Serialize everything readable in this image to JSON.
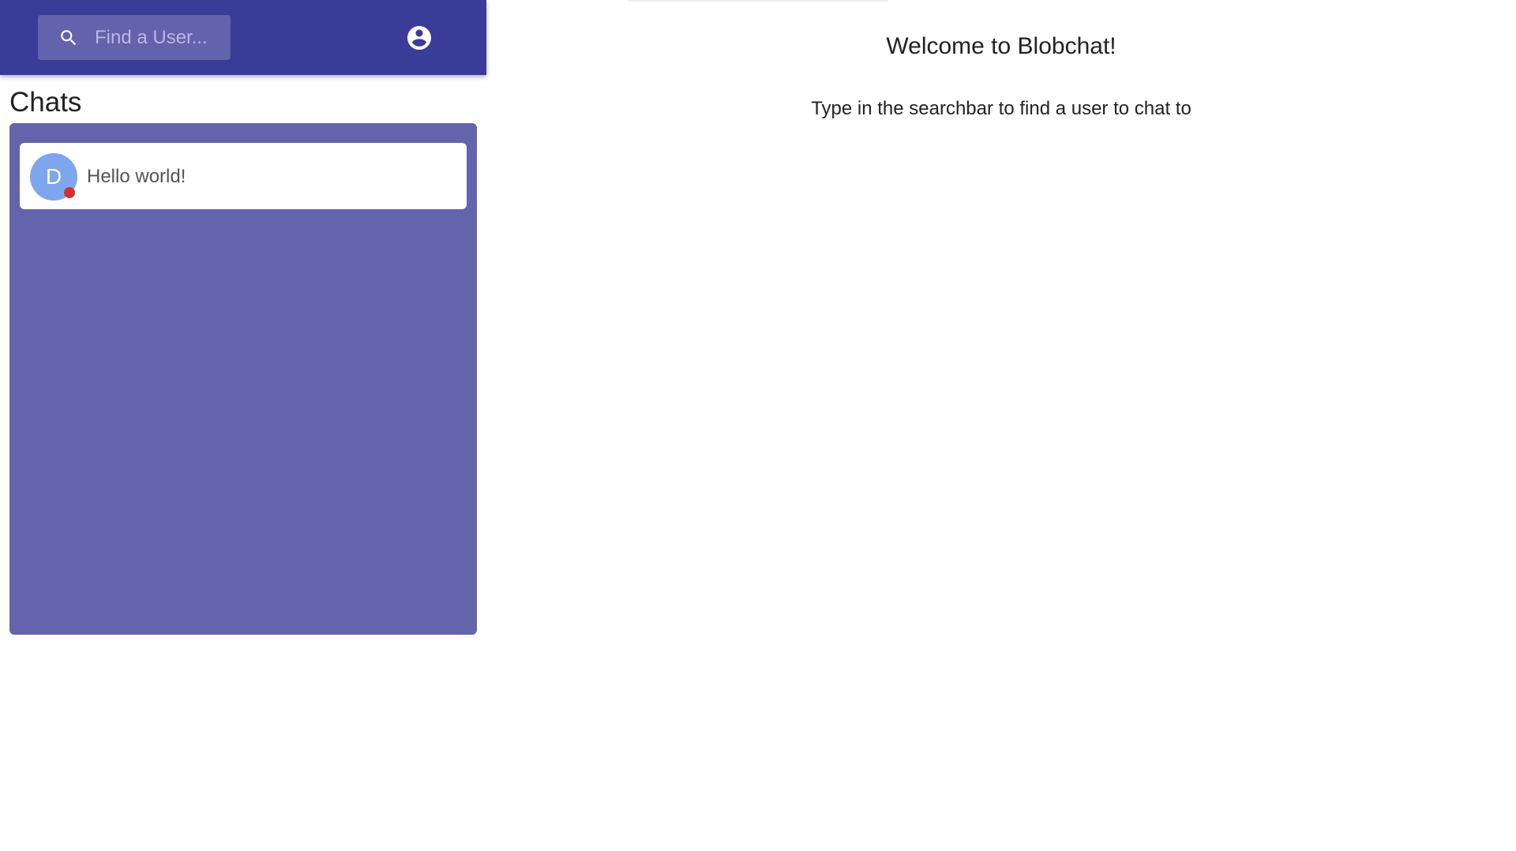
{
  "header": {
    "search": {
      "placeholder": "Find a User...",
      "icon": "search-icon"
    },
    "account_icon": "account-circle-icon"
  },
  "sidebar": {
    "title": "Chats",
    "chats": [
      {
        "avatar_letter": "D",
        "preview": "Hello world!",
        "status_color": "#d32f2f"
      }
    ]
  },
  "main": {
    "title": "Welcome to Blobchat!",
    "subtitle": "Type in the searchbar to find a user to chat to"
  },
  "colors": {
    "header_bg": "#3b3b98",
    "panel_bg": "#6464ad",
    "search_bg": "#6262ad",
    "avatar_bg": "#7ea6ee"
  }
}
